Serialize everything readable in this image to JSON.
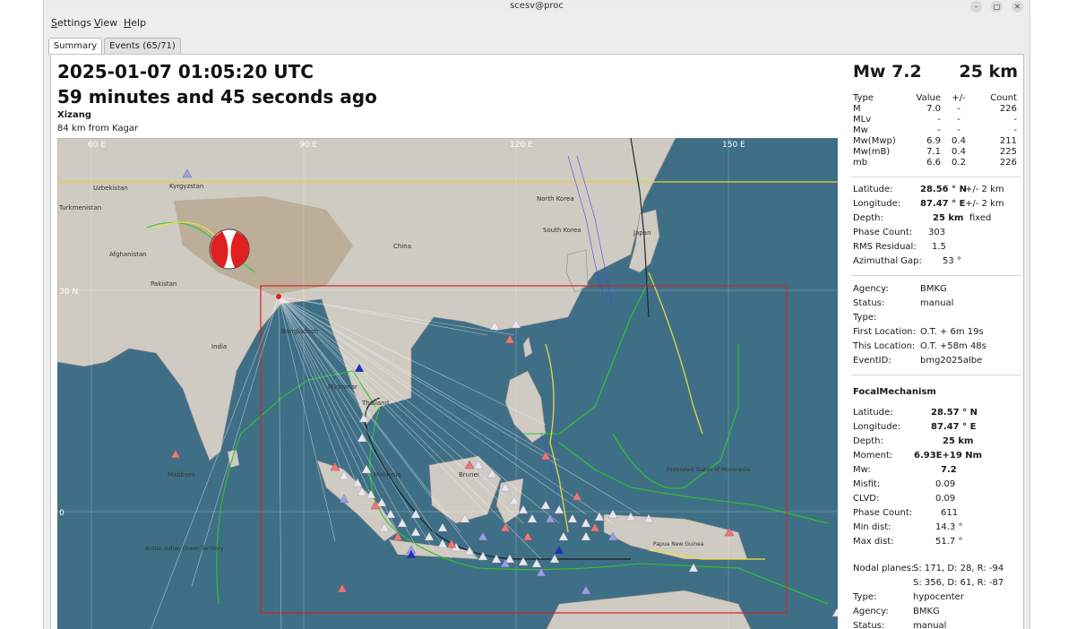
{
  "window": {
    "title": "scesv@proc"
  },
  "menu": [
    {
      "ul": "S",
      "rest": "ettings"
    },
    {
      "ul": "V",
      "rest": "iew"
    },
    {
      "ul": "H",
      "rest": "elp"
    }
  ],
  "tabs": {
    "summary": "Summary",
    "events": "Events (65/71)"
  },
  "header": {
    "time": "2025-01-07 01:05:20 UTC",
    "ago": "59 minutes and 45 seconds ago",
    "region": "Xizang",
    "nearest": "84 km from Kagar"
  },
  "map": {
    "lon_labels": [
      "60 E",
      "90 E",
      "120 E",
      "150 E"
    ],
    "lat_labels": [
      "30 N",
      "0"
    ],
    "place_labels": [
      "Uzbekistan",
      "Kyrgyzstan",
      "Turkmenistan",
      "Afghanistan",
      "Pakistan",
      "India",
      "China",
      "North Korea",
      "South Korea",
      "Japan",
      "Bangladesh",
      "Myanmar",
      "Thailand",
      "Malaysia",
      "Brunei",
      "Maldives",
      "British Indian Ocean Territory",
      "Federated States of Micronesia",
      "Papua New Guinea"
    ],
    "colors": {
      "ocean": "#3f6f86",
      "land": "#cfcac2",
      "region_box": "#d22525",
      "equator_line": "#e6d23a",
      "plate": "#2ec52e"
    }
  },
  "summary": {
    "mag_label": "Mw  7.2",
    "depth": "25 km",
    "mag_headers": {
      "type": "Type",
      "value": "Value",
      "pm": "+/-",
      "count": "Count"
    },
    "magnitudes": [
      {
        "type": "M",
        "value": "7.0",
        "pm": "-",
        "count": "226"
      },
      {
        "type": "MLv",
        "value": "-",
        "pm": "-",
        "count": "-"
      },
      {
        "type": "Mw",
        "value": "-",
        "pm": "-",
        "count": "-"
      },
      {
        "type": "Mw(Mwp)",
        "value": "6.9",
        "pm": "0.4",
        "count": "211"
      },
      {
        "type": "Mw(mB)",
        "value": "7.1",
        "pm": "0.4",
        "count": "225"
      },
      {
        "type": "mb",
        "value": "6.6",
        "pm": "0.2",
        "count": "226"
      }
    ],
    "origin": {
      "lat_label": "Latitude:",
      "lat": "28.56 ° N",
      "lat_pm": "+/-   2 km",
      "lon_label": "Longitude:",
      "lon": "87.47 ° E",
      "lon_pm": "+/-   2 km",
      "depth_label": "Depth:",
      "depth": "25  km",
      "depth_type": "fixed",
      "phase_label": "Phase Count:",
      "phase": "303",
      "rms_label": "RMS Residual:",
      "rms": "1.5",
      "gap_label": "Azimuthal Gap:",
      "gap": "53 °"
    },
    "agency": {
      "agency_label": "Agency:",
      "agency": "BMKG",
      "status_label": "Status:",
      "status": "manual",
      "type_label": "Type:",
      "type": "",
      "first_label": "First Location:",
      "first": "O.T. + 6m 19s",
      "this_label": "This Location:",
      "this": "O.T. +58m 48s",
      "event_label": "EventID:",
      "event": "bmg2025albe"
    },
    "focal": {
      "title": "FocalMechanism",
      "lat_label": "Latitude:",
      "lat": "28.57 ° N",
      "lon_label": "Longitude:",
      "lon": "87.47 ° E",
      "depth_label": "Depth:",
      "depth": "25  km",
      "moment_label": "Moment:",
      "moment": "6.93E+19  Nm",
      "mw_label": "Mw:",
      "mw": "7.2",
      "misfit_label": "Misfit:",
      "misfit": "0.09",
      "clvd_label": "CLVD:",
      "clvd": "0.09",
      "phase_label": "Phase Count:",
      "phase": "611",
      "min_label": "Min dist:",
      "min": "14.3 °",
      "max_label": "Max dist:",
      "max": "51.7 °",
      "np_label": "Nodal planes:",
      "np1": "S: 171, D: 28, R: -94",
      "np2": "S: 356, D: 61, R: -87",
      "type_label": "Type:",
      "type": "hypocenter",
      "agency_label": "Agency:",
      "agency": "BMKG",
      "status_label": "Status:",
      "status": "manual"
    }
  }
}
